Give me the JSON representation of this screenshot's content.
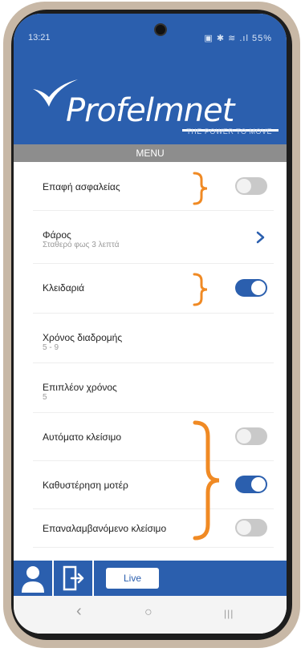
{
  "status_bar": {
    "time": "13:21",
    "icons_text": "▣ ✱ ≋ .ıl 55%"
  },
  "logo": {
    "brand": "Profelmnet",
    "tagline": "THE POWER TO MOVE"
  },
  "menu_title": "MENU",
  "items": [
    {
      "label": "Επαφή ασφαλείας",
      "type": "toggle",
      "on": false
    },
    {
      "label": "Φάρος",
      "sub": "Σταθερό φως 3 λεπτά",
      "type": "link"
    },
    {
      "label": "Κλειδαριά",
      "type": "toggle",
      "on": true
    },
    {
      "label": "Χρόνος διαδρομής",
      "sub": "5 - 9",
      "type": "value"
    },
    {
      "label": "Επιπλέον χρόνος",
      "sub": "5",
      "type": "value"
    },
    {
      "label": "Αυτόματο κλείσιμο",
      "type": "toggle",
      "on": false
    },
    {
      "label": "Καθυστέρηση μοτέρ",
      "type": "toggle",
      "on": true
    },
    {
      "label": "Επαναλαμβανόμενο κλείσιμο",
      "type": "toggle",
      "on": false
    }
  ],
  "actions": {
    "live_label": "Live"
  },
  "nav": {
    "back": "‹",
    "home": "○",
    "recents": "|||"
  },
  "colors": {
    "brand_blue": "#2b5fae",
    "annotation_orange": "#f08a24",
    "menu_gray": "#8d8d8d"
  }
}
